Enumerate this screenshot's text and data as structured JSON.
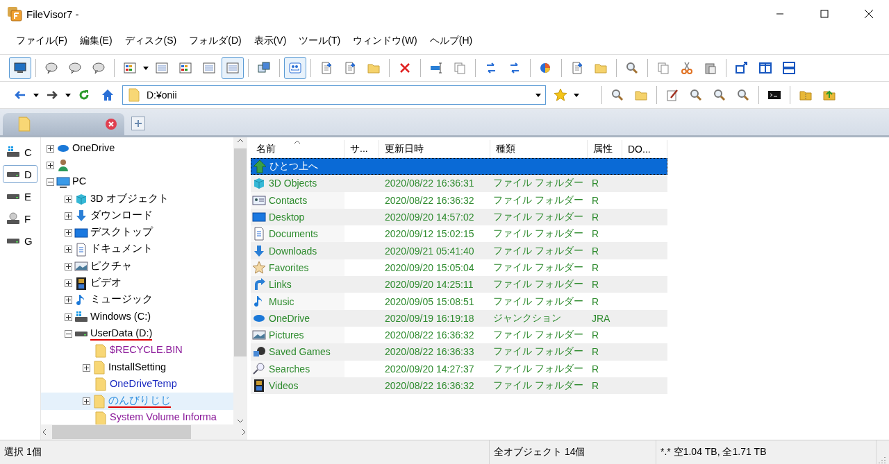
{
  "window": {
    "title": "FileVisor7 -"
  },
  "menu": [
    "ファイル(F)",
    "編集(E)",
    "ディスク(S)",
    "フォルダ(D)",
    "表示(V)",
    "ツール(T)",
    "ウィンドウ(W)",
    "ヘルプ(H)"
  ],
  "toolbar": [
    [
      {
        "pressed": true
      }
    ],
    [
      {
        "pressed": false
      },
      {
        "pressed": false
      },
      {
        "pressed": false
      }
    ],
    [
      {
        "pressed": false
      },
      {
        "pressed": false
      },
      {
        "pressed": false
      },
      {
        "pressed": false
      },
      {
        "pressed": true
      }
    ],
    [
      {
        "pressed": false
      }
    ],
    [
      {
        "pressed": true
      }
    ],
    [
      {
        "pressed": false
      },
      {
        "pressed": false
      },
      {
        "pressed": false
      }
    ],
    [
      {
        "pressed": false
      }
    ],
    [
      {
        "pressed": false
      },
      {
        "pressed": false
      }
    ],
    [
      {
        "pressed": false
      },
      {
        "pressed": false
      }
    ],
    [
      {
        "pressed": false
      }
    ],
    [
      {
        "pressed": false
      },
      {
        "pressed": false
      }
    ],
    [
      {
        "pressed": false
      }
    ],
    [
      {
        "pressed": false
      },
      {
        "pressed": false
      },
      {
        "pressed": false
      }
    ],
    [
      {
        "pressed": false
      },
      {
        "pressed": false
      },
      {
        "pressed": false
      }
    ]
  ],
  "address": {
    "value": "D:¥onii"
  },
  "drives": [
    {
      "letter": "C",
      "kind": "system",
      "selected": false
    },
    {
      "letter": "D",
      "kind": "disk",
      "selected": true
    },
    {
      "letter": "E",
      "kind": "disk",
      "selected": false
    },
    {
      "letter": "F",
      "kind": "optical",
      "selected": false
    },
    {
      "letter": "G",
      "kind": "disk",
      "selected": false
    }
  ],
  "tree": [
    {
      "label": "OneDrive",
      "kind": "cloud",
      "has_children": true,
      "expanded": false,
      "selected": false,
      "underlined": false
    },
    {
      "kind": "user",
      "has_children": true,
      "expanded": false,
      "selected": false
    },
    {
      "label": "PC",
      "kind": "pc",
      "has_children": true,
      "expanded": true,
      "selected": false,
      "underlined": false,
      "children": [
        {
          "label": "3D オブジェクト",
          "kind": "cube",
          "has_children": true,
          "expanded": false,
          "selected": false,
          "underlined": false
        },
        {
          "label": "ダウンロード",
          "kind": "download",
          "has_children": true,
          "expanded": false,
          "selected": false,
          "underlined": false
        },
        {
          "label": "デスクトップ",
          "kind": "desktop",
          "has_children": true,
          "expanded": false,
          "selected": false,
          "underlined": false
        },
        {
          "label": "ドキュメント",
          "kind": "document",
          "has_children": true,
          "expanded": false,
          "selected": false,
          "underlined": false
        },
        {
          "label": "ピクチャ",
          "kind": "picture",
          "has_children": true,
          "expanded": false,
          "selected": false,
          "underlined": false
        },
        {
          "label": "ビデオ",
          "kind": "video",
          "has_children": true,
          "expanded": false,
          "selected": false,
          "underlined": false
        },
        {
          "label": "ミュージック",
          "kind": "music",
          "has_children": true,
          "expanded": false,
          "selected": false,
          "underlined": false
        },
        {
          "label": "Windows (C:)",
          "kind": "system",
          "has_children": true,
          "expanded": false,
          "selected": false,
          "underlined": false
        },
        {
          "label": "UserData (D:)",
          "kind": "drive",
          "has_children": true,
          "expanded": true,
          "selected": false,
          "underlined": true,
          "children": [
            {
              "label": "$RECYCLE.BIN",
              "kind": "folder",
              "color": "#8b1a9a",
              "has_children": false,
              "selected": false,
              "underlined": false
            },
            {
              "label": "InstallSetting",
              "kind": "folder",
              "color": "#000000",
              "has_children": true,
              "expanded": false,
              "selected": false,
              "underlined": false
            },
            {
              "label": "OneDriveTemp",
              "kind": "folder",
              "color": "#1a2ac0",
              "has_children": false,
              "selected": false,
              "underlined": false
            },
            {
              "label": "のんびりじじ",
              "kind": "folder",
              "color": "#2f8fe0",
              "has_children": true,
              "expanded": false,
              "selected": true,
              "underlined": true
            },
            {
              "label": "System Volume Informa",
              "kind": "folder",
              "color": "#8b1a9a",
              "has_children": false,
              "selected": false,
              "underlined": false
            }
          ]
        }
      ]
    }
  ],
  "table": {
    "columns": [
      {
        "label": "名前",
        "sorted": true
      },
      {
        "label": "サ...",
        "sorted": false
      },
      {
        "label": "更新日時",
        "sorted": false
      },
      {
        "label": "種類",
        "sorted": false
      },
      {
        "label": "属性",
        "sorted": false
      },
      {
        "label": "DO...",
        "sorted": false
      }
    ],
    "rows": [
      {
        "name": "ひとつ上へ",
        "kind": "up",
        "selected": true
      },
      {
        "name": "3D Objects",
        "kind": "cube",
        "date": "2020/08/22 16:36:31",
        "type": "ファイル フォルダー",
        "attr": "R",
        "selected": false
      },
      {
        "name": "Contacts",
        "kind": "contact",
        "date": "2020/08/22 16:36:32",
        "type": "ファイル フォルダー",
        "attr": "R",
        "selected": false
      },
      {
        "name": "Desktop",
        "kind": "desktop",
        "date": "2020/09/20 14:57:02",
        "type": "ファイル フォルダー",
        "attr": "R",
        "selected": false
      },
      {
        "name": "Documents",
        "kind": "document",
        "date": "2020/09/12 15:02:15",
        "type": "ファイル フォルダー",
        "attr": "R",
        "selected": false
      },
      {
        "name": "Downloads",
        "kind": "download",
        "date": "2020/09/21 05:41:40",
        "type": "ファイル フォルダー",
        "attr": "R",
        "selected": false
      },
      {
        "name": "Favorites",
        "kind": "star",
        "date": "2020/09/20 15:05:04",
        "type": "ファイル フォルダー",
        "attr": "R",
        "selected": false
      },
      {
        "name": "Links",
        "kind": "link",
        "date": "2020/09/20 14:25:11",
        "type": "ファイル フォルダー",
        "attr": "R",
        "selected": false
      },
      {
        "name": "Music",
        "kind": "music",
        "date": "2020/09/05 15:08:51",
        "type": "ファイル フォルダー",
        "attr": "R",
        "selected": false
      },
      {
        "name": "OneDrive",
        "kind": "cloud",
        "date": "2020/09/19 16:19:18",
        "type": "ジャンクション",
        "attr": "JRA",
        "selected": false
      },
      {
        "name": "Pictures",
        "kind": "picture",
        "date": "2020/08/22 16:36:32",
        "type": "ファイル フォルダー",
        "attr": "R",
        "selected": false
      },
      {
        "name": "Saved Games",
        "kind": "game",
        "date": "2020/08/22 16:36:33",
        "type": "ファイル フォルダー",
        "attr": "R",
        "selected": false
      },
      {
        "name": "Searches",
        "kind": "search",
        "date": "2020/09/20 14:27:37",
        "type": "ファイル フォルダー",
        "attr": "R",
        "selected": false
      },
      {
        "name": "Videos",
        "kind": "video",
        "date": "2020/08/22 16:36:32",
        "type": "ファイル フォルダー",
        "attr": "R",
        "selected": false
      }
    ]
  },
  "status_bar": {
    "selection": "選択 1個",
    "objects": "全オブジェクト 14個",
    "space": "*.* 空1.04 TB, 全1.71 TB"
  }
}
